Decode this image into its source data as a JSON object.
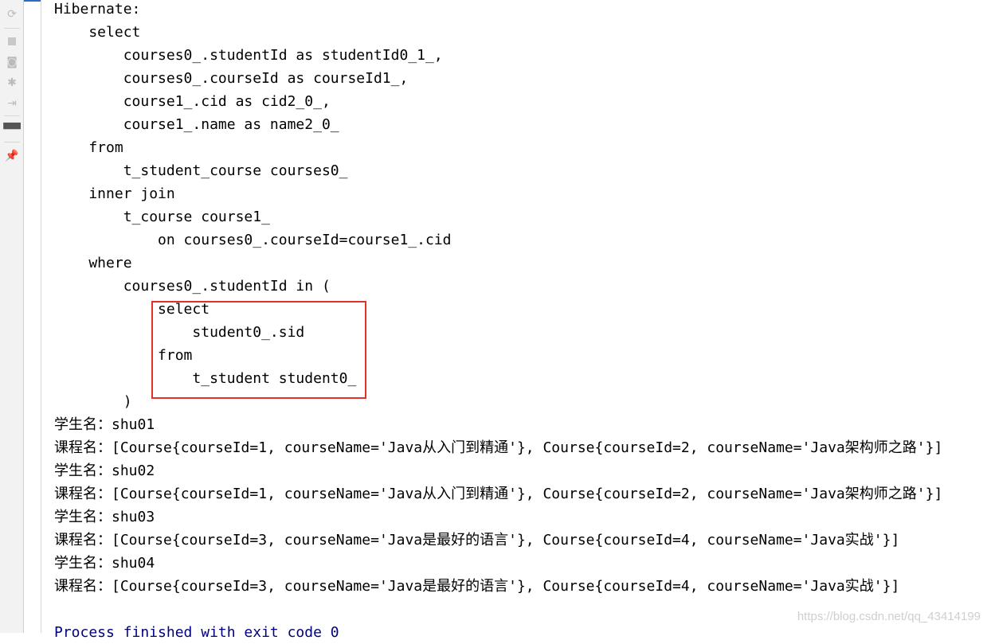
{
  "toolbar": {
    "icons": [
      "rerun-icon",
      "stop-icon",
      "camera-icon",
      "debug-icon",
      "login-icon",
      "layout-icon",
      "pin-icon"
    ]
  },
  "console": {
    "lines": [
      "Hibernate: ",
      "    select",
      "        courses0_.studentId as studentId0_1_,",
      "        courses0_.courseId as courseId1_,",
      "        course1_.cid as cid2_0_,",
      "        course1_.name as name2_0_ ",
      "    from",
      "        t_student_course courses0_ ",
      "    inner join",
      "        t_course course1_ ",
      "            on courses0_.courseId=course1_.cid ",
      "    where",
      "        courses0_.studentId in (",
      "            select",
      "                student0_.sid ",
      "            from",
      "                t_student student0_",
      "        )",
      "学生名：shu01",
      "课程名：[Course{courseId=1, courseName='Java从入门到精通'}, Course{courseId=2, courseName='Java架构师之路'}]",
      "学生名：shu02",
      "课程名：[Course{courseId=1, courseName='Java从入门到精通'}, Course{courseId=2, courseName='Java架构师之路'}]",
      "学生名：shu03",
      "课程名：[Course{courseId=3, courseName='Java是最好的语言'}, Course{courseId=4, courseName='Java实战'}]",
      "学生名：shu04",
      "课程名：[Course{courseId=3, courseName='Java是最好的语言'}, Course{courseId=4, courseName='Java实战'}]",
      "",
      "Process finished with exit code 0"
    ]
  },
  "watermark": "https://blog.csdn.net/qq_43414199",
  "colors": {
    "highlight_box": "#e0312b",
    "process_text": "#000080"
  }
}
